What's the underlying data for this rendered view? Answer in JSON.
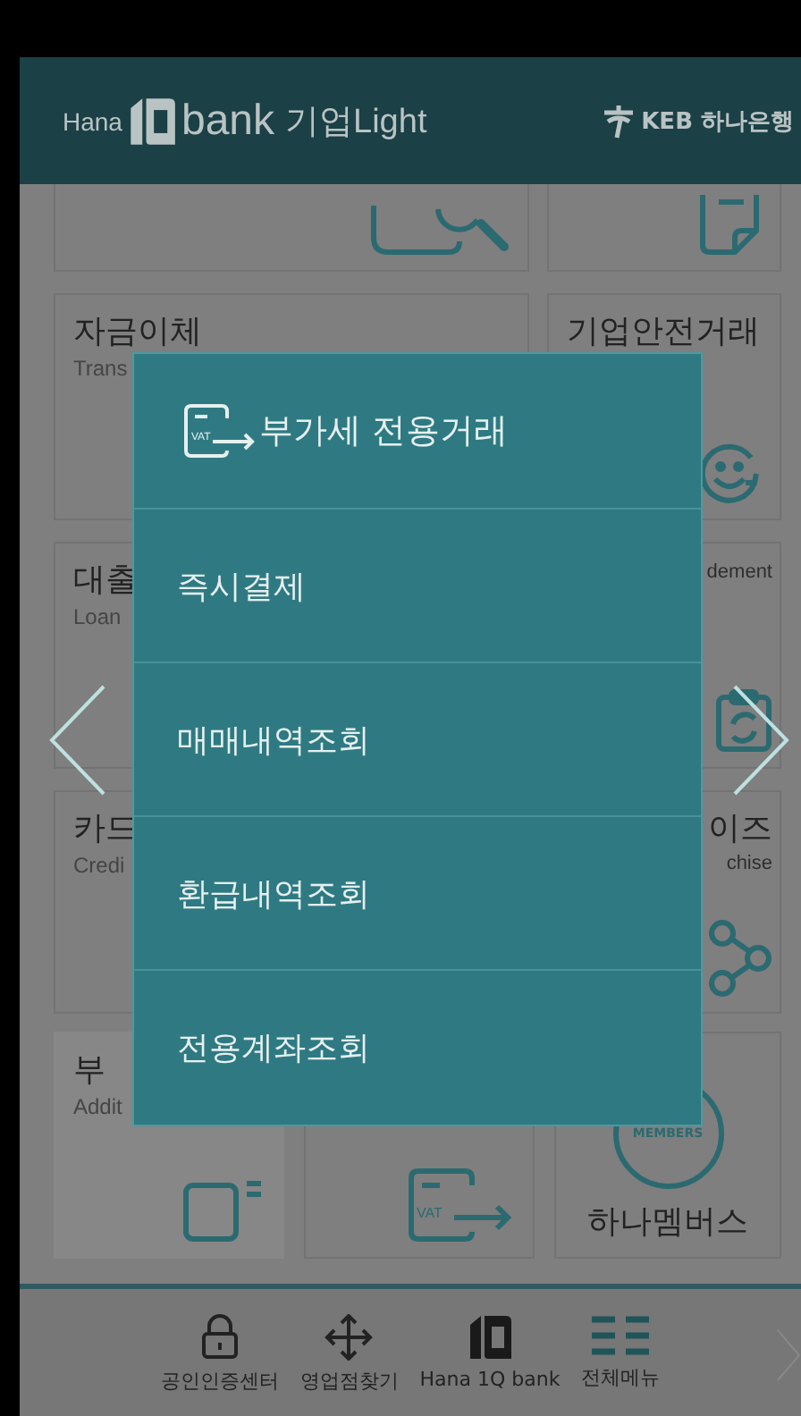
{
  "header": {
    "brand_prefix": "Hana",
    "brand_name": "bank",
    "brand_suffix": "기업Light",
    "bank_name": "KEB 하나은행"
  },
  "tiles": [
    {
      "kind": "plain"
    },
    {
      "kind": "plain"
    },
    {
      "kind": "plain",
      "title": "자금이체",
      "subtitle": "Trans"
    },
    {
      "kind": "plain",
      "title": "기업안전거래"
    },
    {
      "kind": "plain",
      "title": "대출",
      "subtitle": "Loan"
    },
    {
      "kind": "right",
      "subtitle": "dement"
    },
    {
      "kind": "plain",
      "title": "카드",
      "subtitle": "Credi"
    },
    {
      "kind": "right",
      "title": "이즈",
      "subtitle": "chise"
    },
    {
      "kind": "shaded",
      "title": "부",
      "subtitle": "Addit"
    },
    {
      "kind": "plain",
      "icon_text": "VAT"
    },
    {
      "kind": "members",
      "badge": "MEMBERS",
      "title": "하나멤버스"
    }
  ],
  "popup": {
    "title": "부가세 전용거래",
    "icon_text": "VAT",
    "items": [
      "즉시결제",
      "매매내역조회",
      "환급내역조회",
      "전용계좌조회"
    ]
  },
  "bottom_nav": [
    {
      "label": "공인인증센터"
    },
    {
      "label": "영업점찾기"
    },
    {
      "label": "Hana 1Q bank"
    },
    {
      "label": "전체메뉴"
    }
  ]
}
